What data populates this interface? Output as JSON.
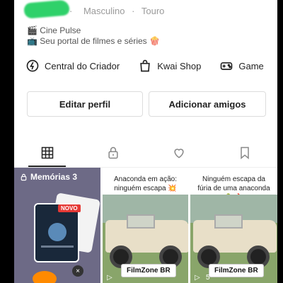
{
  "profile": {
    "gender": "Masculino",
    "zodiac": "Touro",
    "separator": "·",
    "bio_line1": "🎬 Cine Pulse",
    "bio_line2": "📺 Seu portal de filmes e séries 🍿"
  },
  "shortcuts": [
    {
      "label": "Central do Criador",
      "icon": "creator-center-icon"
    },
    {
      "label": "Kwai Shop",
      "icon": "shopping-bag-icon"
    },
    {
      "label": "Game",
      "icon": "gamepad-icon"
    }
  ],
  "actions": {
    "edit_profile": "Editar perfil",
    "add_friends": "Adicionar amigos"
  },
  "tabs": [
    {
      "icon": "grid-icon",
      "active": true
    },
    {
      "icon": "lock-icon",
      "active": false
    },
    {
      "icon": "heart-icon",
      "active": false
    },
    {
      "icon": "bookmark-icon",
      "active": false
    }
  ],
  "grid": {
    "memories": {
      "label": "Memórias 3",
      "badge": "NOVO",
      "close": "×"
    },
    "videos": [
      {
        "caption": "Anaconda em ação: ninguém escapa 💥",
        "brand": "FilmZone BR",
        "play": "▷",
        "count": ""
      },
      {
        "caption": "Ninguém escapa da fúria de uma anaconda 🐍🔥",
        "brand": "FilmZone BR",
        "play": "▷",
        "count": "5"
      }
    ]
  },
  "colors": {
    "redaction": "#2fd16a",
    "badge": "#e53935"
  }
}
